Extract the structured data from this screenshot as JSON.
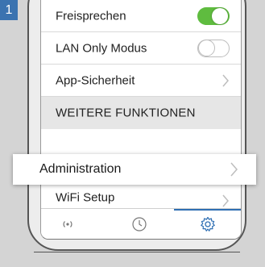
{
  "step_number": "1",
  "settings": {
    "rows": [
      {
        "label": "Freisprechen",
        "toggle": "on"
      },
      {
        "label": "LAN Only Modus",
        "toggle": "off"
      },
      {
        "label": "App-Sicherheit",
        "chevron": true
      }
    ],
    "section_header": "WEITERE FUNKTIONEN",
    "highlighted_row": {
      "label": "Administration"
    },
    "wifi_row": {
      "label": "WiFi Setup"
    }
  },
  "tabbar": {
    "tabs": [
      {
        "icon": "broadcast-icon"
      },
      {
        "icon": "clock-icon"
      },
      {
        "icon": "gear-icon",
        "active": true
      }
    ]
  },
  "colors": {
    "badge": "#3b73b0",
    "toggle_on": "#5fbc3f",
    "active_tab": "#2f6fb3"
  }
}
